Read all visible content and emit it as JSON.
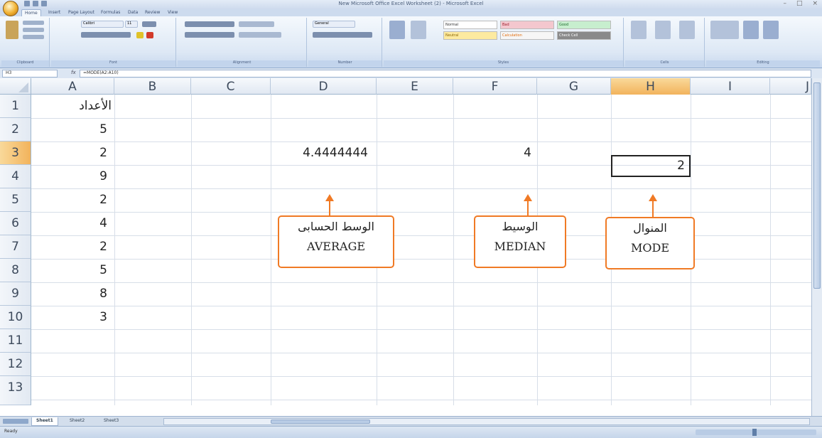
{
  "window": {
    "title": "New Microsoft Office Excel Worksheet (2) - Microsoft Excel",
    "buttons": [
      "–",
      "□",
      "×"
    ]
  },
  "ribbon": {
    "tabs": [
      "Home",
      "Insert",
      "Page Layout",
      "Formulas",
      "Data",
      "Review",
      "View"
    ],
    "groups": [
      "Clipboard",
      "Font",
      "Alignment",
      "Number",
      "Styles",
      "Cells",
      "Editing"
    ],
    "font_name": "Calibri",
    "font_size": "11",
    "number_format": "General",
    "styles": {
      "normal": "Normal",
      "bad": "Bad",
      "good": "Good",
      "neutral": "Neutral",
      "calculation": "Calculation",
      "check_cell": "Check Cell"
    },
    "colors": {
      "bad": "#f4c7ce",
      "good": "#c7eece",
      "neutral": "#fdeaa0",
      "check": "#8a8a8a"
    }
  },
  "formula_bar": {
    "name_box": "H3",
    "fx": "fx",
    "formula": "=MODE(A2:A10)"
  },
  "grid": {
    "columns": [
      "A",
      "B",
      "C",
      "D",
      "E",
      "F",
      "G",
      "H",
      "I",
      "J"
    ],
    "active_column": "H",
    "rows": [
      "1",
      "2",
      "3",
      "4",
      "5",
      "6",
      "7",
      "8",
      "9",
      "10",
      "11",
      "12",
      "13"
    ],
    "active_row": "3",
    "column_a_header": "الأعداد",
    "column_a_values": [
      "5",
      "2",
      "9",
      "2",
      "4",
      "2",
      "5",
      "8",
      "3"
    ],
    "d3": "4.4444444",
    "f3": "4",
    "h3": "2"
  },
  "callouts": {
    "average": {
      "arabic": "الوسط الحسابى",
      "english": "AVERAGE"
    },
    "median": {
      "arabic": "الوسيط",
      "english": "MEDIAN"
    },
    "mode": {
      "arabic": "المنوال",
      "english": "MODE"
    },
    "color": "#f07a25"
  },
  "sheets": [
    "Sheet1",
    "Sheet2",
    "Sheet3"
  ],
  "status": {
    "left": "Ready"
  }
}
